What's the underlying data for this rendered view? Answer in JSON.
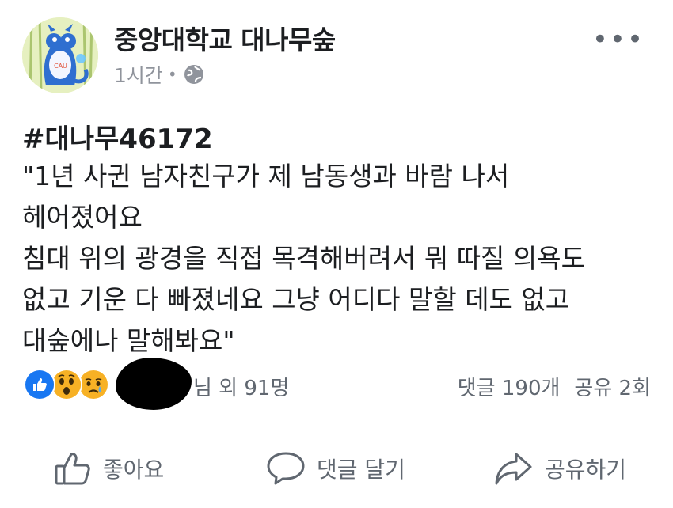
{
  "post": {
    "page_name": "중앙대학교 대나무숲",
    "time": "1시간",
    "hashtag": "#대나무46172",
    "body_lines": [
      "\"1년 사귄 남자친구가 제 남동생과 바람 나서",
      "헤어졌어요",
      "침대 위의 광경을 직접 목격해버려서 뭐 따질 의욕도",
      "없고 기운 다 빠졌네요 그냥 어디다 말할 데도 없고",
      "대숲에나 말해봐요\""
    ]
  },
  "engagement": {
    "reactors_suffix": "님 외 91명",
    "comments": "댓글 190개",
    "shares": "공유 2회"
  },
  "actions": {
    "like": "좋아요",
    "comment": "댓글 달기",
    "share": "공유하기"
  },
  "icons": {
    "more": "more-horizontal-icon",
    "privacy": "globe-icon",
    "reactions": [
      "like-reaction-icon",
      "wow-reaction-icon",
      "sad-reaction-icon"
    ]
  },
  "colors": {
    "like_blue": "#1877f2",
    "reaction_yellow": "#f7b125",
    "muted_text": "#606770"
  }
}
